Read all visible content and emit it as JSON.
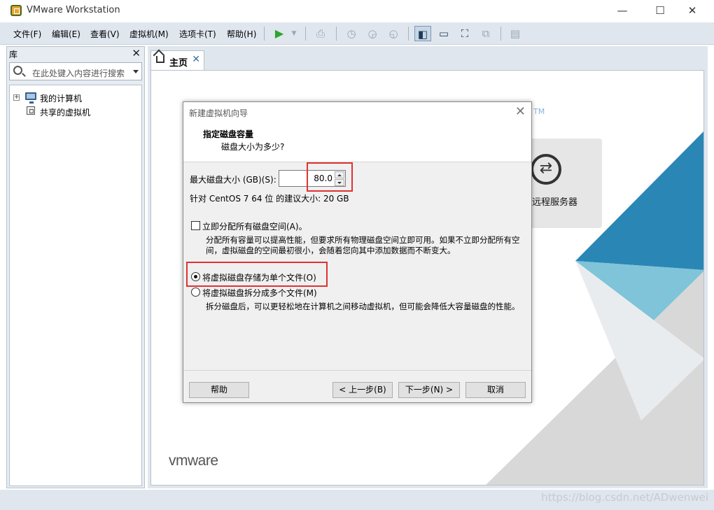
{
  "window": {
    "title": "VMware Workstation",
    "minimize": "—",
    "maximize": "☐",
    "close": "✕"
  },
  "menu": [
    "文件(F)",
    "编辑(E)",
    "查看(V)",
    "虚拟机(M)",
    "选项卡(T)",
    "帮助(H)"
  ],
  "library": {
    "title": "库",
    "close": "✕",
    "search_placeholder": "在此处键入内容进行搜索",
    "tree": [
      {
        "label": "我的计算机",
        "expander": "+"
      },
      {
        "label": "共享的虚拟机"
      }
    ]
  },
  "tabs": [
    {
      "label": "主页",
      "close": "✕"
    }
  ],
  "home": {
    "tm": "TM",
    "remote_server": "远程服务器",
    "logo": "vmware"
  },
  "watermark": "https://blog.csdn.net/ADwenwei",
  "dialog": {
    "title": "新建虚拟机向导",
    "close": "✕",
    "heading": "指定磁盘容量",
    "subheading": "磁盘大小为多少?",
    "max_size_label": "最大磁盘大小 (GB)(S):",
    "max_size_value": "80.0",
    "recommended": "针对 CentOS 7 64 位 的建议大小: 20 GB",
    "allocate_label": "立即分配所有磁盘空间(A)。",
    "allocate_checked": false,
    "allocate_desc": "分配所有容量可以提高性能，但要求所有物理磁盘空间立即可用。如果不立即分配所有空间，虚拟磁盘的空间最初很小，会随着您向其中添加数据而不断变大。",
    "single_file_label": "将虚拟磁盘存储为单个文件(O)",
    "single_file_checked": true,
    "multi_file_label": "将虚拟磁盘拆分成多个文件(M)",
    "multi_file_desc": "拆分磁盘后，可以更轻松地在计算机之间移动虚拟机，但可能会降低大容量磁盘的性能。",
    "buttons": {
      "help": "帮助",
      "back": "< 上一步(B)",
      "next": "下一步(N) >",
      "cancel": "取消"
    }
  },
  "colors": {
    "highlight": "#e03232",
    "chrome": "#dfe6ee",
    "accent_teal": "#7fc4d8",
    "accent_blue": "#2a86b5"
  }
}
